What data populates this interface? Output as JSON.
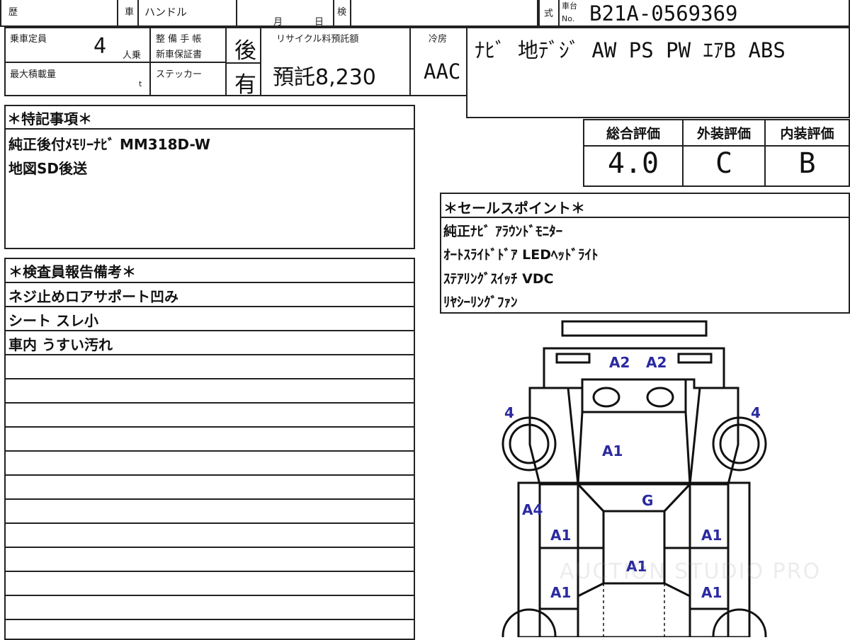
{
  "header": {
    "history_label": "歴",
    "car_label": "車",
    "handle_label": "ハンドル",
    "month_label": "月",
    "day_label": "日",
    "inspect_label": "検",
    "model_label": "式",
    "chassis_label_top": "車台",
    "chassis_label_bottom": "No.",
    "chassis_number": "B21A-0569369"
  },
  "specs": {
    "capacity_label": "乗車定員",
    "capacity_value": "4",
    "capacity_unit": "人乗",
    "max_load_label": "最大積載量",
    "max_load_unit": "t",
    "maintenance_label": "整 備 手 帳",
    "new_car_warranty_label": "新車保証書",
    "sticker_label": "ステッカー",
    "maintenance_value": "後",
    "sticker_value": "有",
    "recycle_label": "リサイクル料預託額",
    "recycle_value": "預託8,230",
    "cooler_label": "冷房",
    "cooler_value": "AAC",
    "equipment": "ﾅﾋﾞ 地ﾃﾞｼﾞ AW PS PW ｴｱB ABS"
  },
  "special_notes": {
    "title": "＊特記事項＊",
    "lines": [
      "純正後付ﾒﾓﾘｰﾅﾋﾞ MM318D-W",
      "地図SD後送"
    ]
  },
  "grades": {
    "overall_label": "総合評価",
    "overall_value": "4.0",
    "exterior_label": "外装評価",
    "exterior_value": "C",
    "interior_label": "内装評価",
    "interior_value": "B"
  },
  "sales_points": {
    "title": "＊セールスポイント＊",
    "lines": [
      "純正ﾅﾋﾞ ｱﾗｳﾝﾄﾞﾓﾆﾀｰ",
      "ｵｰﾄｽﾗｲﾄﾞﾄﾞｱ LEDﾍｯﾄﾞﾗｲﾄ",
      "ｽﾃｱﾘﾝｸﾞｽｲｯﾁ VDC",
      "ﾘﾔｼｰﾘﾝｸﾞﾌｧﾝ"
    ]
  },
  "inspector": {
    "title": "＊検査員報告備考＊",
    "lines": [
      "ネジ止めロアサポート凹み",
      "シート スレ小",
      "車内 うすい汚れ"
    ]
  },
  "damage_marks": {
    "front_left": "A2",
    "front_right": "A2",
    "wheel_fl": "4",
    "wheel_fr": "4",
    "hood": "A1",
    "windshield": "G",
    "fender_left": "A4",
    "door_fl": "A1",
    "door_fr": "A1",
    "roof": "A1",
    "door_rl": "A1",
    "door_rr": "A1"
  },
  "watermark": "AUCTION STUDIO PRO"
}
